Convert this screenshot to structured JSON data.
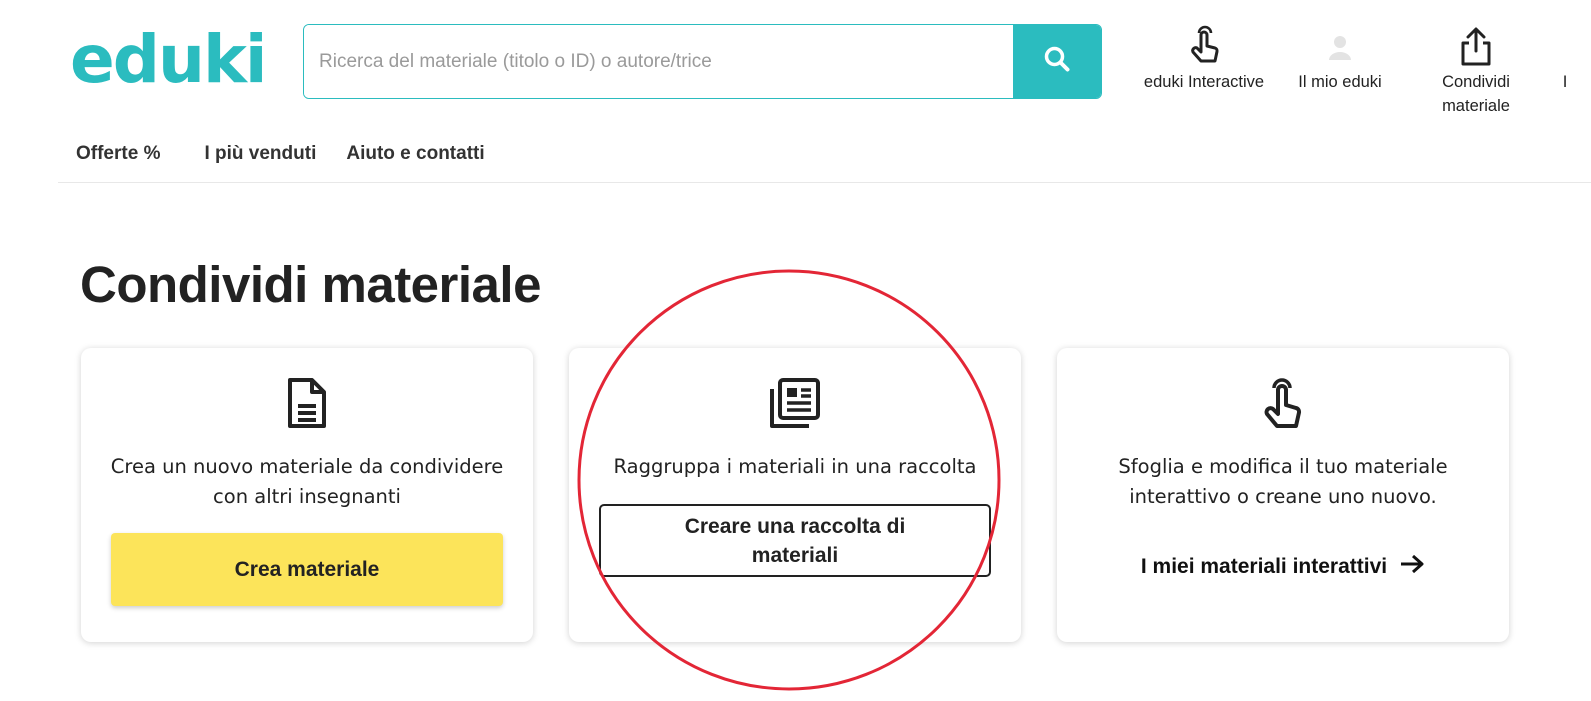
{
  "header": {
    "logo_text": "eduki",
    "search": {
      "placeholder": "Ricerca del materiale (titolo o ID) o autore/trice",
      "icon": "search-icon"
    },
    "actions": [
      {
        "label": "eduki Interactive",
        "icon": "touch-hand-icon"
      },
      {
        "label": "Il mio eduki",
        "icon": "user-icon"
      },
      {
        "label": "Condividi materiale",
        "icon": "share-upload-icon"
      }
    ],
    "overflow_label": "I"
  },
  "nav": {
    "items": [
      "Offerte %",
      "I più venduti",
      "Aiuto e contatti"
    ]
  },
  "page": {
    "title": "Condividi materiale"
  },
  "cards": [
    {
      "icon": "document-icon",
      "text": "Crea un nuovo materiale da condividere con altri insegnanti",
      "button": "Crea materiale"
    },
    {
      "icon": "collection-icon",
      "text": "Raggruppa i materiali in una raccolta",
      "button": "Creare una raccolta di materiali"
    },
    {
      "icon": "touch-hand-icon",
      "text": "Sfoglia e modifica il tuo materiale interattivo o creane uno nuovo.",
      "link": "I miei materiali interattivi",
      "link_icon": "arrow-right-icon"
    }
  ],
  "colors": {
    "brand": "#2bbcbf",
    "cta_yellow": "#fce45a",
    "annotation_red": "#e32636"
  }
}
